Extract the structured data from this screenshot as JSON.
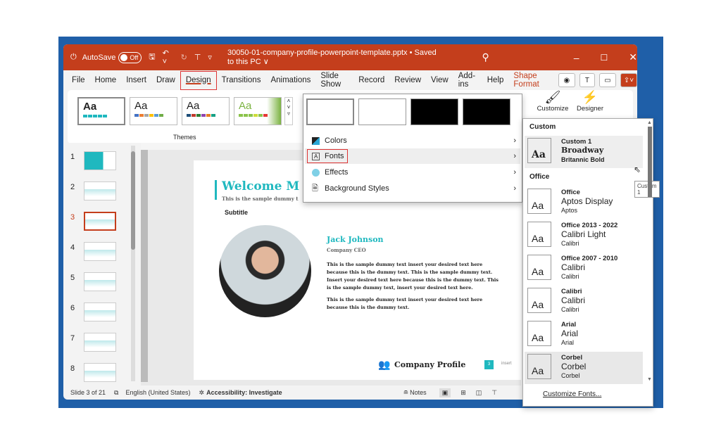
{
  "titlebar": {
    "autosave": "AutoSave",
    "toggle": "Off",
    "filename": "30050-01-company-profile-powerpoint-template.pptx • Saved to this PC ∨"
  },
  "tabs": [
    "File",
    "Home",
    "Insert",
    "Draw",
    "Design",
    "Transitions",
    "Animations",
    "Slide Show",
    "Record",
    "Review",
    "View",
    "Add-ins",
    "Help",
    "Shape Format"
  ],
  "ribbon": {
    "theme_sample": "Aa",
    "themes_label": "Themes",
    "customize": "Customize",
    "designer": "Designer"
  },
  "variants_menu": {
    "items": [
      "Colors",
      "Fonts",
      "Effects",
      "Background Styles"
    ]
  },
  "slides": [
    "1",
    "2",
    "3",
    "4",
    "5",
    "6",
    "7",
    "8"
  ],
  "current_slide": 3,
  "slide": {
    "title": "Welcome M",
    "subtitle_line": "This is the sample dummy t",
    "subtitle": "Subtitle",
    "name": "Jack Johnson",
    "role": "Company CEO",
    "para1": "This is the sample dummy text insert your desired text here because this is the dummy text. This is the sample dummy text. Insert your desired text here because this is the dummy text. This is the sample dummy text, insert your desired text here.",
    "para2": "This is the sample dummy text insert your desired text here because this is the dummy text.",
    "footer": "Company Profile",
    "page": "3",
    "footer_right": "insert"
  },
  "fonts_panel": {
    "custom_header": "Custom",
    "office_header": "Office",
    "tooltip": "Custom 1",
    "customize": "Customize Fonts...",
    "custom": {
      "name": "Custom 1",
      "heading": "Broadway",
      "body": "Britannic Bold"
    },
    "items": [
      {
        "name": "Office",
        "heading": "Aptos Display",
        "body": "Aptos"
      },
      {
        "name": "Office 2013 - 2022",
        "heading": "Calibri Light",
        "body": "Calibri"
      },
      {
        "name": "Office 2007 - 2010",
        "heading": "Calibri",
        "body": "Calibri"
      },
      {
        "name": "Calibri",
        "heading": "Calibri",
        "body": "Calibri"
      },
      {
        "name": "Arial",
        "heading": "Arial",
        "body": "Arial"
      },
      {
        "name": "Corbel",
        "heading": "Corbel",
        "body": "Corbel"
      }
    ]
  },
  "status": {
    "slide": "Slide 3 of 21",
    "language": "English (United States)",
    "accessibility": "Accessibility: Investigate",
    "notes": "Notes"
  },
  "colors": {
    "accent": "#c43e1c",
    "teal": "#1fb8bf",
    "window_bg": "#1f5fa8"
  }
}
